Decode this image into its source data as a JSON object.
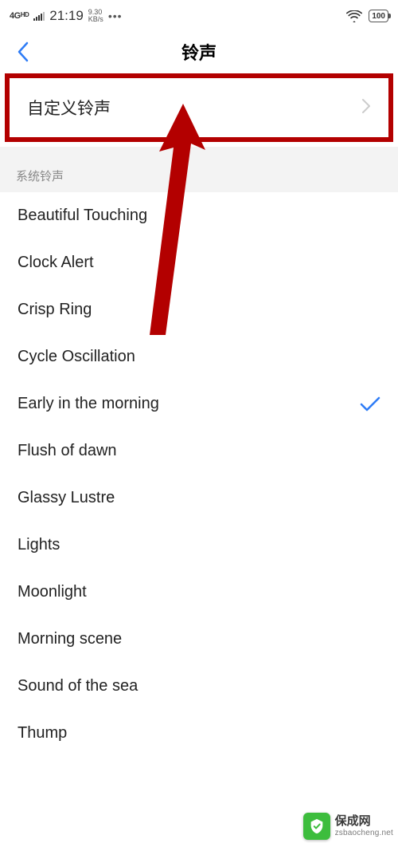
{
  "status_bar": {
    "network_label": "4G",
    "network_sup": "HD",
    "time": "21:19",
    "speed_value": "9.30",
    "speed_unit": "KB/s",
    "battery_text": "100"
  },
  "header": {
    "title": "铃声"
  },
  "custom_row": {
    "label": "自定义铃声"
  },
  "section": {
    "system_label": "系统铃声"
  },
  "ringtones": [
    {
      "name": "Beautiful Touching",
      "selected": false
    },
    {
      "name": "Clock Alert",
      "selected": false
    },
    {
      "name": "Crisp Ring",
      "selected": false
    },
    {
      "name": "Cycle Oscillation",
      "selected": false
    },
    {
      "name": "Early in the morning",
      "selected": true
    },
    {
      "name": "Flush of dawn",
      "selected": false
    },
    {
      "name": "Glassy Lustre",
      "selected": false
    },
    {
      "name": "Lights",
      "selected": false
    },
    {
      "name": "Moonlight",
      "selected": false
    },
    {
      "name": "Morning scene",
      "selected": false
    },
    {
      "name": "Sound of the sea",
      "selected": false
    },
    {
      "name": "Thump",
      "selected": false
    }
  ],
  "watermark": {
    "brand_cn": "保成网",
    "brand_en": "zsbaocheng.net"
  }
}
